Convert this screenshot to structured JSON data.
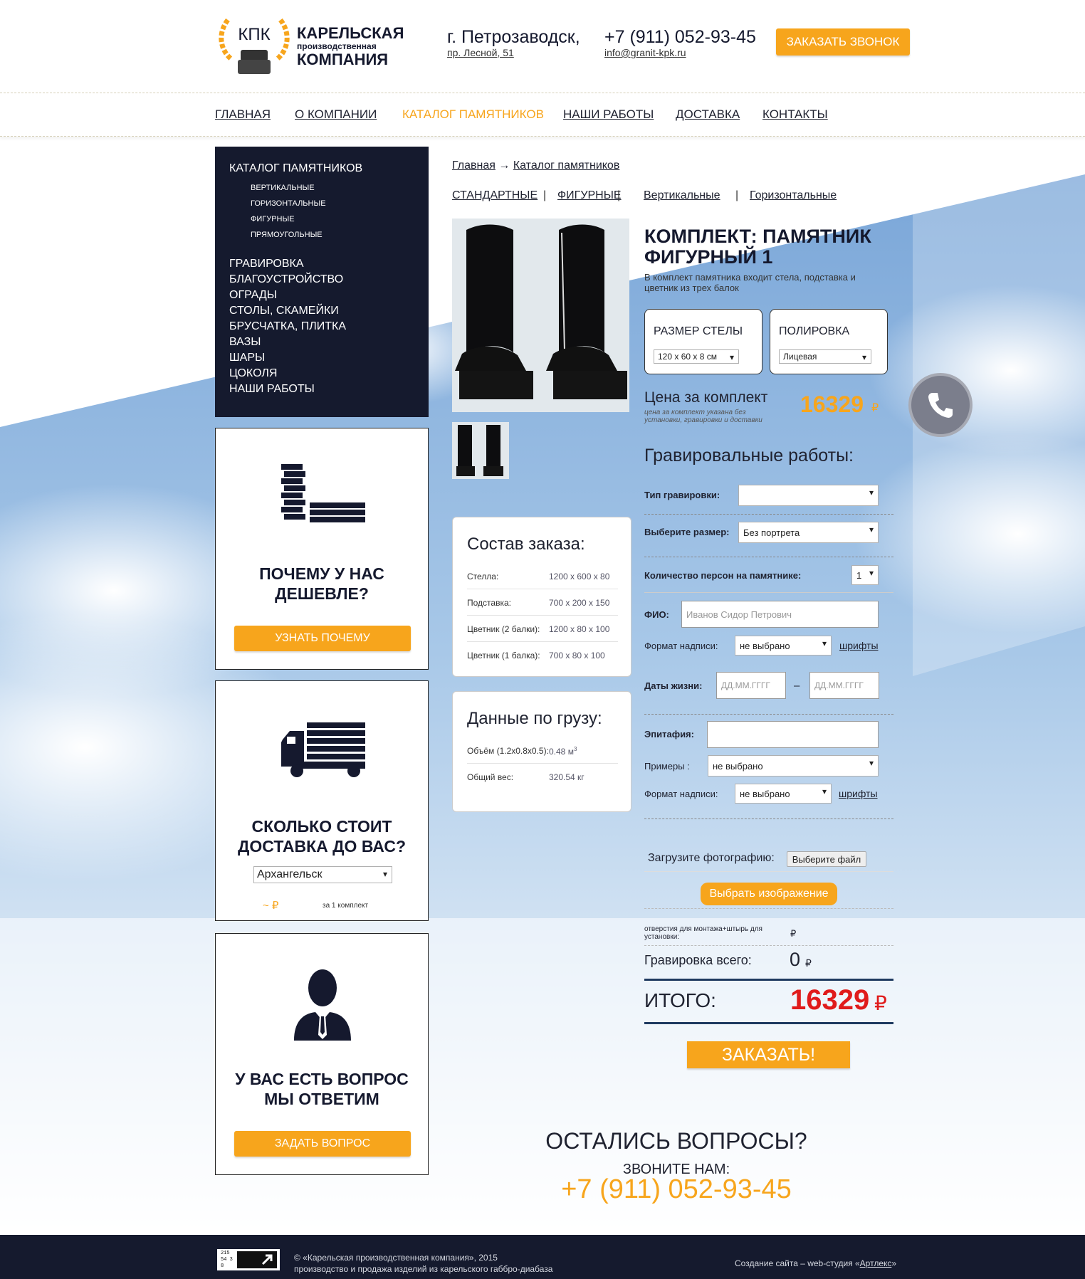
{
  "header": {
    "logo_abbr": "КПК",
    "logo_line1": "КАРЕЛЬСКАЯ",
    "logo_line2": "производственная",
    "logo_line3": "КОМПАНИЯ",
    "city": "г. Петрозаводск,",
    "address": "пр. Лесной, 51",
    "phone": "+7 (911) 052-93-45",
    "email": "info@granit-kpk.ru",
    "callback_label": "ЗАКАЗАТЬ ЗВОНОК"
  },
  "nav": {
    "items": [
      "ГЛАВНАЯ",
      "О КОМПАНИИ",
      "КАТАЛОГ ПАМЯТНИКОВ",
      "НАШИ РАБОТЫ",
      "ДОСТАВКА",
      "КОНТАКТЫ"
    ],
    "active": "КАТАЛОГ ПАМЯТНИКОВ"
  },
  "sidebar": {
    "title": "КАТАЛОГ ПАМЯТНИКОВ",
    "subitems": [
      "ВЕРТИКАЛЬНЫЕ",
      "ГОРИЗОНТАЛЬНЫЕ",
      "ФИГУРНЫЕ",
      "ПРЯМОУГОЛЬНЫЕ"
    ],
    "items": [
      "ГРАВИРОВКА",
      "БЛАГОУСТРОЙСТВО",
      "ОГРАДЫ",
      "СТОЛЫ, СКАМЕЙКИ",
      "БРУСЧАТКА, ПЛИТКА",
      "ВАЗЫ",
      "ШАРЫ",
      "ЦОКОЛЯ",
      "НАШИ РАБОТЫ"
    ]
  },
  "widgets": {
    "cheaper": {
      "title_line1": "ПОЧЕМУ У НАС",
      "title_line2": "ДЕШЕВЛЕ?",
      "button": "УЗНАТЬ ПОЧЕМУ"
    },
    "delivery": {
      "title_line1": "СКОЛЬКО СТОИТ",
      "title_line2": "ДОСТАВКА ДО ВАС?",
      "city_selected": "Архангельск",
      "price": "~ ₽",
      "price_note": "за 1 комплект"
    },
    "question": {
      "title_line1": "У ВАС ЕСТЬ ВОПРОС",
      "title_line2": "МЫ ОТВЕТИМ",
      "button": "ЗАДАТЬ ВОПРОС"
    }
  },
  "breadcrumbs": {
    "home": "Главная",
    "arrow": "→",
    "current": "Каталог памятников"
  },
  "filters": {
    "items": [
      "СТАНДАРТНЫЕ",
      "ФИГУРНЫЕ",
      "Вертикальные",
      "Горизонтальные"
    ],
    "separator": "|"
  },
  "order_card": {
    "title": "Состав заказа:",
    "rows": [
      {
        "label": "Стелла:",
        "value": "1200 x 600 x 80"
      },
      {
        "label": "Подставка:",
        "value": "700 x 200 x 150"
      },
      {
        "label": "Цветник (2 балки):",
        "value": "1200 x 80 x 100"
      },
      {
        "label": "Цветник (1 балка):",
        "value": "700 x 80 x 100"
      }
    ]
  },
  "cargo_card": {
    "title": "Данные по грузу:",
    "volume_label": "Объём (1.2x0.8x0.5):",
    "volume_value": "0.48 м",
    "volume_sup": "3",
    "weight_label": "Общий вес:",
    "weight_value": "320.54 кг"
  },
  "product": {
    "title": "КОМПЛЕКТ: ПАМЯТНИК ФИГУРНЫЙ 1",
    "description": "В комплект памятника входит стела, подставка и цветник из трех балок",
    "size_label": "РАЗМЕР СТЕЛЫ",
    "size_value": "120 x 60 x 8 см",
    "polish_label": "ПОЛИРОВКА",
    "polish_value": "Лицевая",
    "price_label": "Цена за комплект",
    "price_note": "цена за комплект указана без установки, гравировки и доставки",
    "price": "16329",
    "currency": "₽"
  },
  "engraving": {
    "title": "Гравировальные работы:",
    "type_label": "Тип гравировки:",
    "type_value": "",
    "size_label": "Выберите размер:",
    "size_value": "Без портрета",
    "persons_label": "Количество персон на памятнике:",
    "persons_value": "1",
    "fio_label": "ФИО:",
    "fio_placeholder": "Иванов Сидор Петрович",
    "format_label": "Формат надписи:",
    "format_value": "не выбрано",
    "fonts_link": "шрифты",
    "dates_label": "Даты жизни:",
    "date_placeholder": "ДД.ММ.ГГГГ",
    "dash": "–",
    "epitaph_label": "Эпитафия:",
    "examples_label": "Примеры :",
    "examples_value": "не выбрано",
    "format2_label": "Формат надписи:",
    "format2_value": "не выбрано",
    "upload_label": "Загрузите фотографию:",
    "upload_button": "Выберите файл",
    "choose_image": "Выбрать изображение",
    "holes_label": "отверстия для монтажа+штырь для установки:",
    "holes_currency": "₽",
    "engraving_total_label": "Гравировка всего:",
    "engraving_total_value": "0",
    "engraving_total_currency": "₽"
  },
  "total": {
    "label": "ИТОГО:",
    "value": "16329",
    "currency": "₽",
    "order_button": "ЗАКАЗАТЬ!"
  },
  "questions": {
    "title": "ОСТАЛИСЬ ВОПРОСЫ?",
    "subtitle": "ЗВОНИТЕ НАМ:",
    "phone": "+7 (911) 052-93-45"
  },
  "footer": {
    "logo_text": "215 54 38",
    "copyright": "© «Карельская производственная компания», 2015",
    "tagline": "производство и продажа изделий из карельского габбро-диабаза",
    "studio_prefix": "Создание сайта – web-студия «",
    "studio_link": "Артлекс",
    "studio_suffix": "»"
  },
  "colors": {
    "accent": "#f7a51c",
    "dark": "#151a2e",
    "total_red": "#e01b1b"
  }
}
